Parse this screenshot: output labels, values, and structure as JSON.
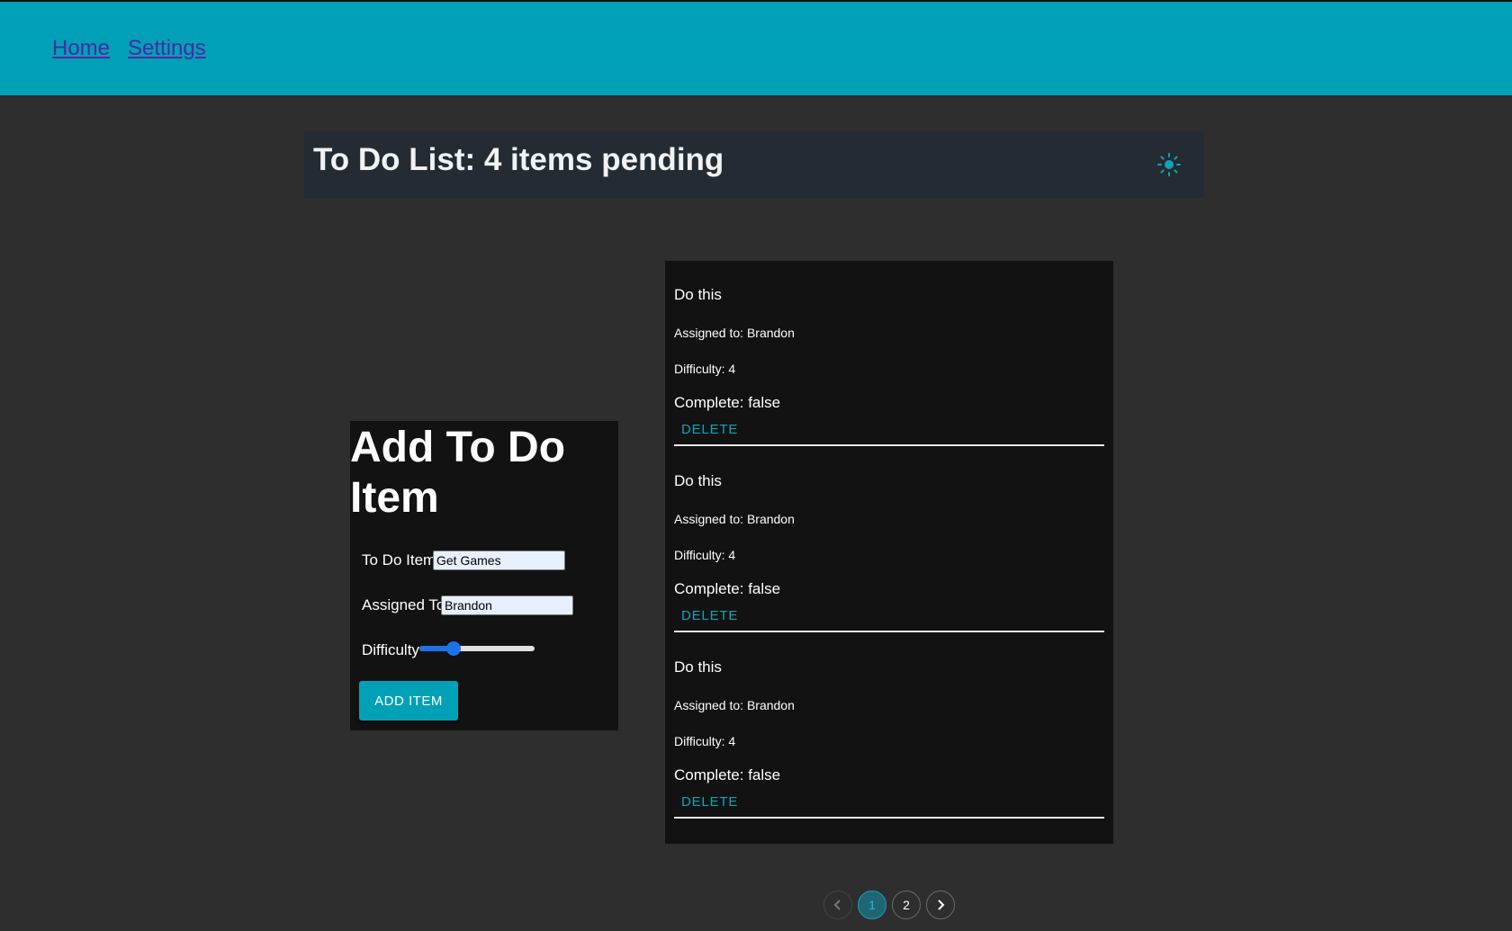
{
  "nav": {
    "home_label": "Home",
    "settings_label": "Settings"
  },
  "header": {
    "title": "To Do List: 4 items pending",
    "theme_icon": "sun-icon"
  },
  "form": {
    "title": "Add To Do Item",
    "todo_label": "To Do Item",
    "todo_value": "Get Games",
    "assigned_label": "Assigned To",
    "assigned_value": "Brandon",
    "difficulty_label": "Difficulty",
    "difficulty_value": 0.3,
    "submit_label": "ADD ITEM"
  },
  "todos": [
    {
      "text": "Do this",
      "assignee": "Assigned to: Brandon",
      "difficulty": "Difficulty: 4",
      "complete": "Complete: false",
      "delete_label": "DELETE"
    },
    {
      "text": "Do this",
      "assignee": "Assigned to: Brandon",
      "difficulty": "Difficulty: 4",
      "complete": "Complete: false",
      "delete_label": "DELETE"
    },
    {
      "text": "Do this",
      "assignee": "Assigned to: Brandon",
      "difficulty": "Difficulty: 4",
      "complete": "Complete: false",
      "delete_label": "DELETE"
    }
  ],
  "pagination": {
    "pages": [
      "1",
      "2"
    ],
    "current": "1"
  },
  "colors": {
    "accent": "#00a1b6",
    "background": "#2e2e2e",
    "card": "#121212"
  }
}
